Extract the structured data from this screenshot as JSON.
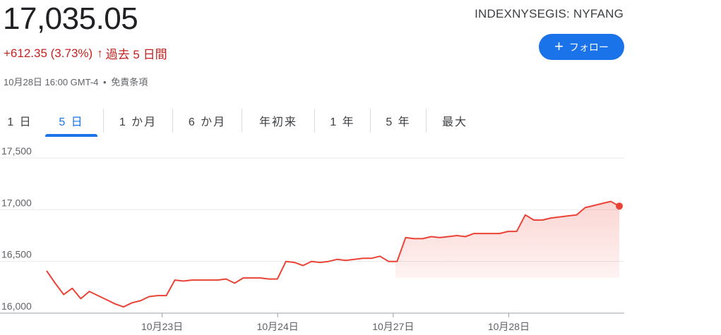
{
  "quote": {
    "price": "17,035.05",
    "change": "+612.35 (3.73%)",
    "change_arrow": "↑",
    "period": "過去 5 日間",
    "timestamp": "10月28日 16:00 GMT-4",
    "separator": "•",
    "disclaimer": "免責条項",
    "ticker": "INDEXNYSEGIS: NYFANG"
  },
  "follow_button": {
    "icon": "plus-icon",
    "label": "フォロー"
  },
  "tabs": [
    {
      "label": "1 日",
      "active": false
    },
    {
      "label": "5 日",
      "active": true
    },
    {
      "label": "1 か月",
      "active": false
    },
    {
      "label": "6 か月",
      "active": false
    },
    {
      "label": "年初来",
      "active": false
    },
    {
      "label": "1 年",
      "active": false
    },
    {
      "label": "5 年",
      "active": false
    },
    {
      "label": "最大",
      "active": false
    }
  ],
  "colors": {
    "accent": "#1a73e8",
    "negative_line": "#ea4335",
    "change_text": "#c5221f"
  },
  "chart_data": {
    "type": "area",
    "ylim": [
      16000,
      17500
    ],
    "yticks": [
      "17,500",
      "17,000",
      "16,500",
      "16,000"
    ],
    "ytick_values": [
      17500,
      17000,
      16500,
      16000
    ],
    "xticks": [
      "10月23日",
      "10月24日",
      "10月27日",
      "10月28日"
    ],
    "xtick_positions": [
      10,
      20,
      30,
      40
    ],
    "xrange": [
      0,
      50
    ],
    "series": [
      {
        "values": [
          16410,
          16290,
          16180,
          16240,
          16140,
          16210,
          16170,
          16130,
          16090,
          16060,
          16100,
          16120,
          16160,
          16170,
          16170,
          16320,
          16310,
          16320,
          16320,
          16320,
          16320,
          16330,
          16290,
          16340,
          16340,
          16340,
          16330,
          16330,
          16500,
          16490,
          16460,
          16500,
          16490,
          16500,
          16520,
          16510,
          16520,
          16530,
          16530,
          16550,
          16500,
          16500,
          16730,
          16720,
          16720,
          16740,
          16730,
          16740,
          16750,
          16740,
          16770,
          16770,
          16770,
          16770,
          16790,
          16790,
          16950,
          16900,
          16900,
          16920,
          16930,
          16940,
          16950,
          17020,
          17040,
          17060,
          17080,
          17035
        ]
      }
    ],
    "grid": true,
    "last_point_marker": true
  }
}
